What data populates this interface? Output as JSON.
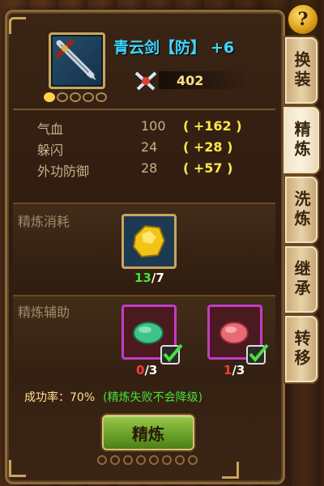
{
  "equipment": {
    "name": "青云剑【防】",
    "plus": "+6",
    "power": "402",
    "stars_total": 5,
    "stars_lit": 1
  },
  "tabs": [
    {
      "label": "换装",
      "active": false
    },
    {
      "label": "精炼",
      "active": true
    },
    {
      "label": "洗炼",
      "active": false
    },
    {
      "label": "继承",
      "active": false
    },
    {
      "label": "转移",
      "active": false
    }
  ],
  "help": {
    "label": "?"
  },
  "stats": [
    {
      "name": "气血",
      "value": "100",
      "bonus": "( +162 )"
    },
    {
      "name": "躲闪",
      "value": "24",
      "bonus": "( +28 )"
    },
    {
      "name": "外功防御",
      "value": "28",
      "bonus": "( +57 )"
    }
  ],
  "cost": {
    "label": "精炼消耗",
    "have": "13",
    "need": "/7"
  },
  "assist": {
    "label": "精炼辅助",
    "slots": [
      {
        "have": "0",
        "need": "/3"
      },
      {
        "have": "1",
        "need": "/3"
      }
    ]
  },
  "rate": {
    "label": "成功率：70%",
    "note": "(精炼失败不会降级)"
  },
  "action": {
    "label": "精炼"
  },
  "colors": {
    "name": "#3fd7ff",
    "bonus": "#ffe84a",
    "have_ok": "#44e23c",
    "have_low": "#ff3a3a",
    "button": "#6aa22a"
  }
}
